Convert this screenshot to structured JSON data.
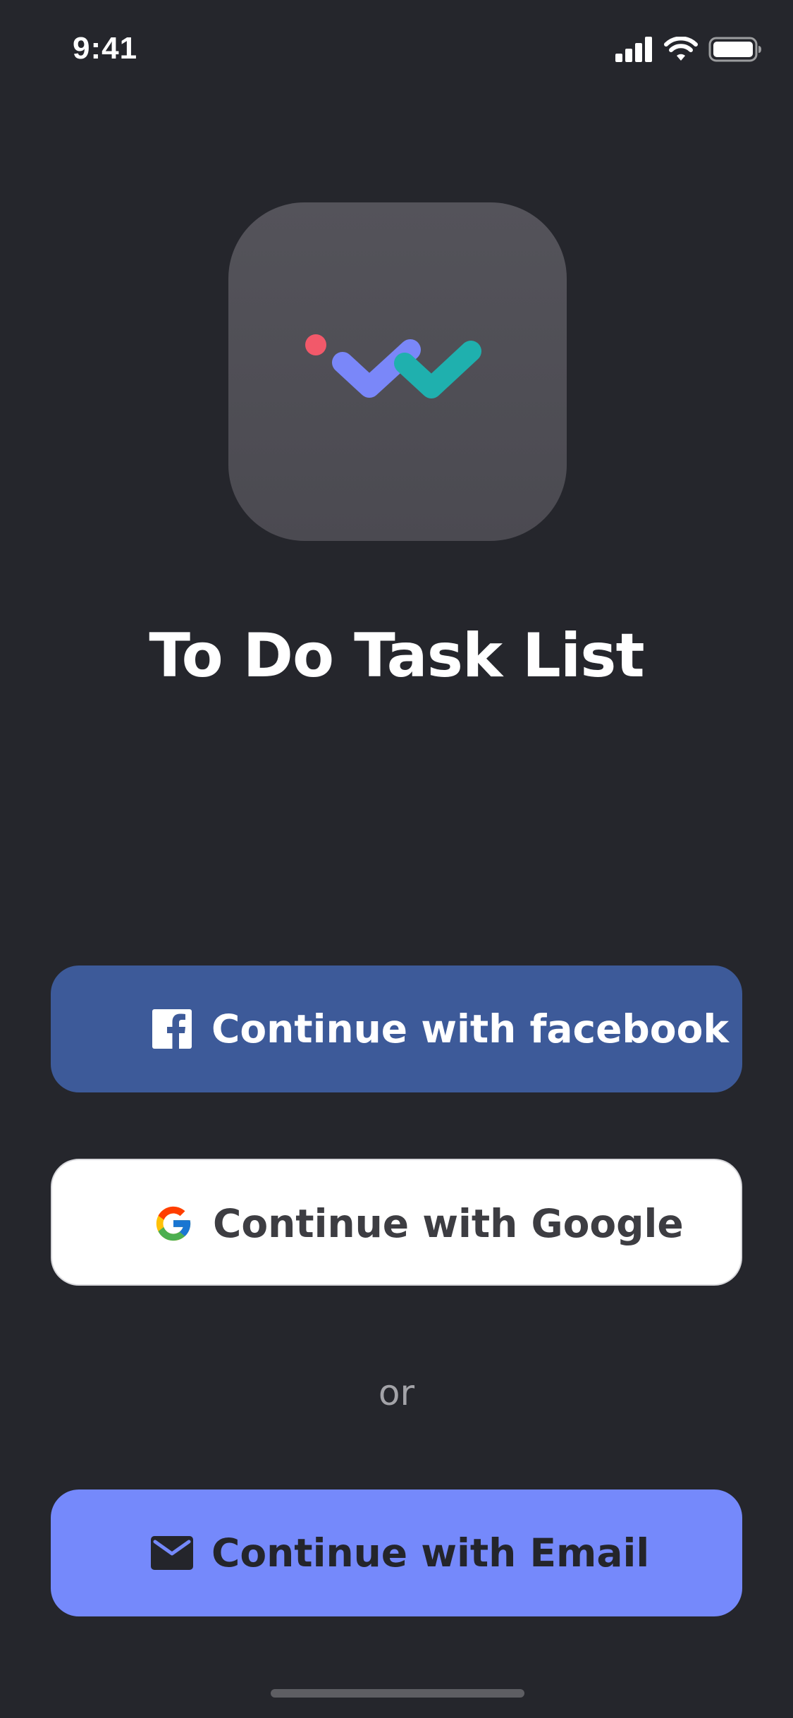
{
  "status_bar": {
    "time": "9:41",
    "icons": [
      "cellular-signal-icon",
      "wifi-icon",
      "battery-icon"
    ]
  },
  "app": {
    "logo_icon": "checkmarks-logo-icon",
    "title": "To Do Task List"
  },
  "auth": {
    "facebook_label": "Continue with facebook",
    "google_label": "Continue with Google",
    "or_text": "or",
    "email_label": "Continue with Email"
  },
  "colors": {
    "background": "#25262c",
    "facebook": "#3d5a99",
    "google": "#ffffff",
    "email": "#7589fb",
    "logo_red": "#f2596a",
    "logo_purple": "#7a87f9",
    "logo_teal": "#1fb0ae"
  }
}
